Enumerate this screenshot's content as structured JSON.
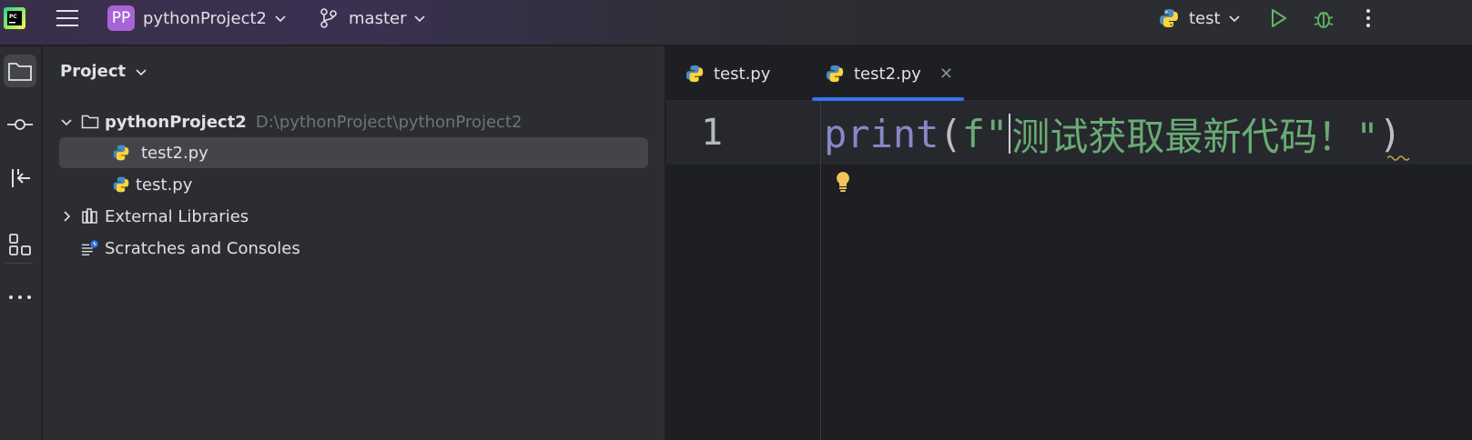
{
  "topbar": {
    "project_badge": "PP",
    "project_name": "pythonProject2",
    "branch": "master",
    "run_config": "test"
  },
  "toolstrip": {
    "items": [
      "project-icon",
      "commit-icon",
      "pull-requests-icon",
      "structure-icon",
      "more-tools-icon"
    ]
  },
  "project_panel": {
    "title": "Project",
    "root": {
      "name": "pythonProject2",
      "path": "D:\\pythonProject\\pythonProject2"
    },
    "files": [
      "test2.py",
      "test.py"
    ],
    "external_libraries": "External Libraries",
    "scratches": "Scratches and Consoles"
  },
  "editor": {
    "tabs": [
      {
        "label": "test.py",
        "active": false
      },
      {
        "label": "test2.py",
        "active": true
      }
    ],
    "line_number": "1",
    "code": {
      "keyword": "print",
      "open_paren": "(",
      "f_prefix": "f\"",
      "string_body": "测试获取最新代码！\"",
      "close_paren": ")"
    }
  },
  "colors": {
    "accent": "#3574f0",
    "project_badge": "#a864d6",
    "run_green": "#5fb865",
    "keyword": "#8888c6",
    "string": "#6aab73"
  }
}
